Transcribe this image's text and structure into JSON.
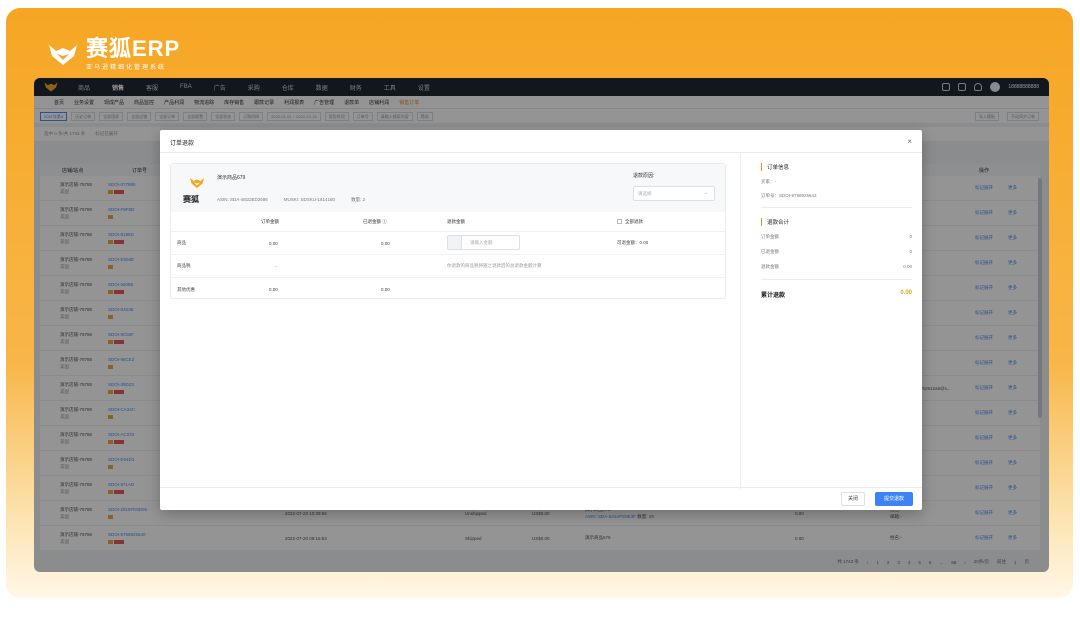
{
  "brand": {
    "name": "赛狐ERP",
    "tagline": "亚马逊精细化管理系统"
  },
  "topnav": {
    "items": [
      "商品",
      "销售",
      "客服",
      "FBA",
      "广告",
      "采购",
      "仓库",
      "数据",
      "财务",
      "工具",
      "设置"
    ],
    "active_index": 1,
    "user": "18888888888"
  },
  "tabs": [
    "首页",
    "业务设置",
    "现成产品",
    "商品监控",
    "产品利润",
    "物流追踪",
    "库存销售",
    "跟款记录",
    "利润报表",
    "广告管理",
    "退款单",
    "店铺利润",
    "销售订单"
  ],
  "filters": [
    "2021年第4",
    "历史订单",
    "全部国家",
    "全部店铺",
    "全部订单",
    "全部配置",
    "全部状态",
    "订购时间",
    "2022-01-01 ~ 2022-10-13",
    "发货时间",
    "订单号",
    "请输入搜索内容",
    "筛选",
    "导入模板",
    "手动同步订单"
  ],
  "subbar": [
    "选中 0 条/共 1743 条",
    "标记已展开"
  ],
  "table": {
    "headers": [
      "店铺/站点",
      "订单号",
      "操作"
    ],
    "rows": [
      {
        "store": "演示店铺-79786",
        "site": "美国",
        "order": "SDOI-077890"
      },
      {
        "store": "演示店铺-79786",
        "site": "美国",
        "order": "SDOI-F8F8D"
      },
      {
        "store": "演示店铺-79786",
        "site": "美国",
        "order": "SDOI-8198D"
      },
      {
        "store": "演示店铺-79786",
        "site": "美国",
        "order": "SDOI-E504E"
      },
      {
        "store": "演示店铺-79786",
        "site": "美国",
        "order": "SDOI-5608E"
      },
      {
        "store": "演示店铺-79786",
        "site": "美国",
        "order": "SDOI-8JS3E"
      },
      {
        "store": "演示店铺-79786",
        "site": "美国",
        "order": "SDOI-9C50F"
      },
      {
        "store": "演示店铺-79786",
        "site": "美国",
        "order": "SDOI-96CE2"
      },
      {
        "store": "演示店铺-79786",
        "site": "美国",
        "order": "SDOI-39D23"
      },
      {
        "store": "演示店铺-79786",
        "site": "美国",
        "order": "SDOI-CA34C"
      },
      {
        "store": "演示店铺-79786",
        "site": "美国",
        "order": "SDOI-AC023"
      },
      {
        "store": "演示店铺-79786",
        "site": "美国",
        "order": "SDOI-E94D3"
      },
      {
        "store": "演示店铺-79786",
        "site": "美国",
        "order": "SDOI-971AD"
      },
      {
        "store": "演示店铺-79786",
        "site": "美国",
        "order": "SDOI-2915FE9D05"
      },
      {
        "store": "演示店铺-79786",
        "site": "美国",
        "order": "SDOI-9798925640"
      }
    ],
    "op1": "标记展开",
    "op2": "更多",
    "row14": {
      "date": "2022-07-23 10:39:56",
      "status": "Unshipped",
      "price": "US$0.00",
      "product": "演示商品679",
      "asin": "ASIN: SDA-624APE9E3F",
      "qty": "数量: 19",
      "amount": "0.00",
      "name": "姓名:-",
      "mail": "邮箱:-"
    },
    "row15": {
      "date": "2022-07-20 09:16:53",
      "status": "Shipped",
      "price": "US$0.00",
      "product": "演示商品679",
      "amount": "0.00",
      "name": "姓名:-"
    },
    "email_frag": "752912a9@s..."
  },
  "pager": {
    "total": "共 1743 条",
    "pages": [
      "1",
      "2",
      "3",
      "4",
      "5",
      "6",
      "...",
      "88"
    ],
    "per_page": "20条/页",
    "goto": "前往",
    "goto_page": "1",
    "page_unit": "页"
  },
  "modal": {
    "title": "订单退款",
    "product": {
      "name": "演示商品679",
      "logo_text": "赛狐",
      "asin": "ASIN: SDA-481DED2686",
      "msku": "MUSKI: SDSKU-1814180",
      "qty": "数量: 2"
    },
    "reason_label": "退款原因:",
    "reason_placeholder": "请选择",
    "cols": {
      "order_amount": "订单金额",
      "refunded": "已退金额",
      "refund_amount": "退款金额",
      "full_refund": "全部退款"
    },
    "rows": {
      "goods": {
        "label": "商品",
        "order": "0.00",
        "refunded": "0.00",
        "input_placeholder": "请输入金额",
        "refundable": "可退金额：0.00"
      },
      "tax": {
        "label": "商品税",
        "order": "-",
        "note": "你退款的商品税将随之退款后的总退款金额计算"
      },
      "other": {
        "label": "其他优惠",
        "order": "0.00",
        "refunded": "0.00"
      }
    },
    "side": {
      "info_title": "订单信息",
      "buyer": "买家：-",
      "order_no": "订单号：SDOI-9798925643",
      "sum_title": "退款合计",
      "kv": [
        {
          "k": "订单金额",
          "v": "0"
        },
        {
          "k": "已退金额",
          "v": "0"
        },
        {
          "k": "退款金额",
          "v": "0.00"
        }
      ],
      "total_label": "累计退款",
      "total_value": "0.00"
    },
    "close_label": "关闭",
    "submit_label": "提交退款"
  },
  "colors": {
    "brand_orange": "#f6a623",
    "accent_blue": "#3d82f6",
    "nav_dark": "#1f2733"
  }
}
